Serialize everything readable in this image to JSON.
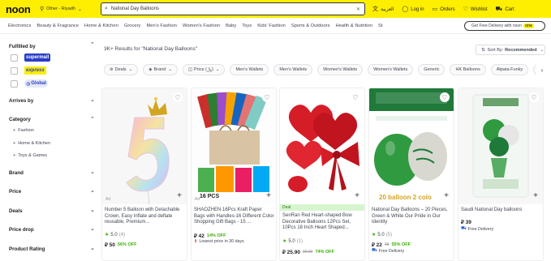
{
  "header": {
    "logo": "noon",
    "location": "Other - Riyadh",
    "search_value": "National Day Balloons",
    "language": "العربية",
    "login": "Log in",
    "orders": "Orders",
    "wishlist": "Wishlist",
    "cart": "Cart"
  },
  "categories": [
    "Electronics",
    "Beauty & Fragrance",
    "Home & Kitchen",
    "Grocery",
    "Men's Fashion",
    "Women's Fashion",
    "Baby",
    "Toys",
    "Kids' Fashion",
    "Sports & Outdoors",
    "Health & Nutrition",
    "St"
  ],
  "fast_delivery": "Get Free Delivery with noon",
  "fast_delivery_badge": "one",
  "sidebar": {
    "fulfilled_by": "Fulfilled by",
    "badges": [
      "supermall",
      "express",
      "Global"
    ],
    "arrives_by": "Arrives by",
    "category": "Category",
    "category_items": [
      "Fashion",
      "Home & Kitchen",
      "Toys & Games"
    ],
    "brand": "Brand",
    "price": "Price",
    "deals": "Deals",
    "price_drop": "Price drop",
    "product_rating": "Product Rating"
  },
  "results": {
    "prefix": "3K+ Results for",
    "query": "\"National Day Balloons\""
  },
  "sort": {
    "label": "Sort By:",
    "value": "Recommended"
  },
  "filters": [
    "Deals",
    "Brand",
    "Price (﷼)",
    "Men's Wallets",
    "Men's Wallets",
    "Women's Wallets",
    "Women's Wallets",
    "Generic",
    "HK Balloons",
    "Atpata Funky",
    "An"
  ],
  "products": [
    {
      "title": "Number 5 Balloon with Detachable Crown, Easy Inflate and deflate reusable, Premium...",
      "rating": "5.0",
      "count": "(4)",
      "price": "⃁ 50",
      "old_price": "",
      "off": "56% OFF",
      "note": "",
      "ad": "Ad",
      "deal": "",
      "overlay": ""
    },
    {
      "title": "SHAOZHEN 16Pcs Kraft Paper Bags with Handles-16 Different Color Shopping Gift Bags - 15 ...",
      "rating": "",
      "count": "",
      "price": "⃁ 42",
      "old_price": "",
      "off": "14% OFF",
      "note": "Lowest price in 30 days",
      "ad": "Ad",
      "deal": "",
      "overlay": "16 PCS"
    },
    {
      "title": "SenRan Red Heart-shaped Bow Decorative Balloons 12Pcs Set, 10Pcs 18 Inch Heart Shaped...",
      "rating": "5.0",
      "count": "(1)",
      "price": "⃁ 25.90",
      "old_price": "99.00",
      "off": "74% OFF",
      "note": "",
      "ad": "",
      "deal": "Deal",
      "overlay": ""
    },
    {
      "title": "National Day Balloons – 20 Pieces, Green & White Our Pride in Our Identity",
      "rating": "5.0",
      "count": "(5)",
      "price": "⃁ 22",
      "old_price": "49",
      "off": "55% OFF",
      "note": "Free Delivery",
      "ad": "",
      "deal": "",
      "overlay": "20 balloon 2 colo"
    },
    {
      "title": "Saudi National Day balloons",
      "rating": "",
      "count": "",
      "price": "⃁ 39",
      "old_price": "",
      "off": "",
      "note": "Free Delivery",
      "ad": "",
      "deal": "",
      "overlay": ""
    }
  ],
  "colors": {
    "brand_yellow": "#feee00",
    "rating_green": "#38ae04",
    "saudi_green": "#1f7a3a"
  }
}
